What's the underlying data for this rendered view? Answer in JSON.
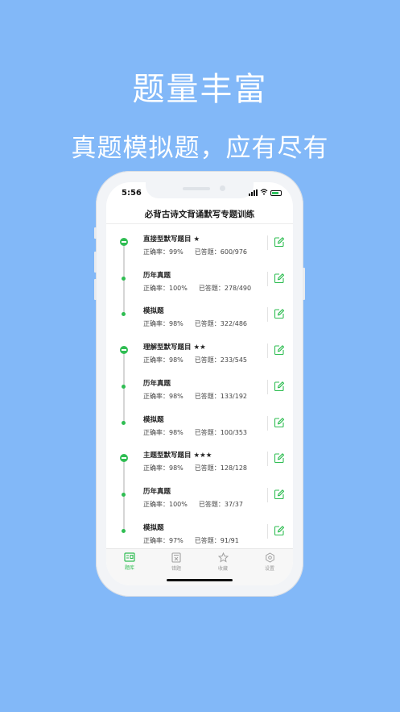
{
  "promo": {
    "headline": "题量丰富",
    "subline": "真题模拟题，应有尽有"
  },
  "status_bar": {
    "time": "5:56"
  },
  "nav": {
    "title": "必背古诗文背诵默写专题训练"
  },
  "colors": {
    "background": "#82b8f8",
    "accent": "#2fbd52"
  },
  "labels": {
    "accuracy": "正确率：",
    "answered": "已答题："
  },
  "groups": [
    {
      "rows": [
        {
          "title": "直接型默写题目 ★",
          "accuracy": "99%",
          "answered": "600/976"
        },
        {
          "title": "历年真题",
          "accuracy": "100%",
          "answered": "278/490"
        },
        {
          "title": "模拟题",
          "accuracy": "98%",
          "answered": "322/486"
        }
      ]
    },
    {
      "rows": [
        {
          "title": "理解型默写题目 ★★",
          "accuracy": "98%",
          "answered": "233/545"
        },
        {
          "title": "历年真题",
          "accuracy": "98%",
          "answered": "133/192"
        },
        {
          "title": "模拟题",
          "accuracy": "98%",
          "answered": "100/353"
        }
      ]
    },
    {
      "rows": [
        {
          "title": "主题型默写题目 ★★★",
          "accuracy": "98%",
          "answered": "128/128"
        },
        {
          "title": "历年真题",
          "accuracy": "100%",
          "answered": "37/37"
        },
        {
          "title": "模拟题",
          "accuracy": "97%",
          "answered": "91/91"
        }
      ]
    }
  ],
  "tabbar": [
    {
      "label": "题库",
      "icon": "question-bank-icon",
      "active": true
    },
    {
      "label": "错题",
      "icon": "wrong-answers-icon",
      "active": false
    },
    {
      "label": "收藏",
      "icon": "star-icon",
      "active": false
    },
    {
      "label": "设置",
      "icon": "settings-icon",
      "active": false
    }
  ]
}
